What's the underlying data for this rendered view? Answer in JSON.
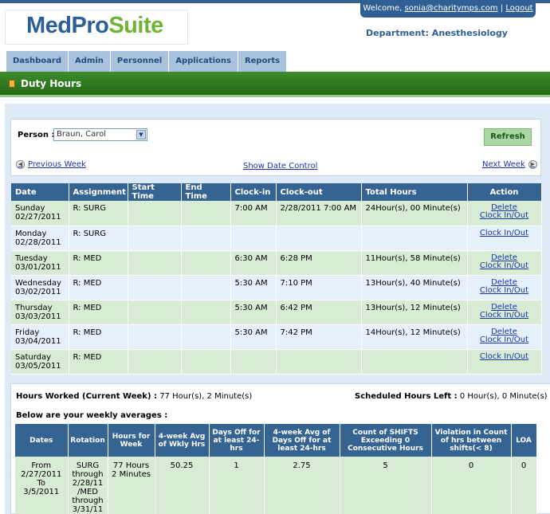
{
  "logo": {
    "part1": "MedPro",
    "part2": "Suite"
  },
  "header": {
    "welcome_prefix": "Welcome,",
    "email": "sonia@charitymps.com",
    "separator": "|",
    "logout": "Logout",
    "department": "Department: Anesthesiology"
  },
  "nav": [
    "Dashboard",
    "Admin",
    "Personnel",
    "Applications",
    "Reports"
  ],
  "page_title": "Duty Hours",
  "filters": {
    "person_label": "Person :",
    "person_value": "Braun, Carol",
    "refresh": "Refresh",
    "previous_week": "Previous Week",
    "show_date_control": "Show Date Control",
    "next_week": "Next Week"
  },
  "duty_table": {
    "headers": [
      "Date",
      "Assignment",
      "Start Time",
      "End Time",
      "Clock-in",
      "Clock-out",
      "Total Hours",
      "Action"
    ],
    "delete_label": "Delete",
    "clock_label": "Clock In/Out",
    "rows": [
      {
        "day": "Sunday",
        "date": "02/27/2011",
        "assignment": "R: SURG",
        "start": "",
        "end": "",
        "clock_in": "7:00 AM",
        "clock_out": "2/28/2011 7:00 AM",
        "total": "24Hour(s), 00 Minute(s)"
      },
      {
        "day": "Monday",
        "date": "02/28/2011",
        "assignment": "R: SURG",
        "start": "",
        "end": "",
        "clock_in": "",
        "clock_out": "",
        "total": ""
      },
      {
        "day": "Tuesday",
        "date": "03/01/2011",
        "assignment": "R: MED",
        "start": "",
        "end": "",
        "clock_in": "6:30 AM",
        "clock_out": "6:28 PM",
        "total": "11Hour(s), 58 Minute(s)"
      },
      {
        "day": "Wednesday",
        "date": "03/02/2011",
        "assignment": "R: MED",
        "start": "",
        "end": "",
        "clock_in": "5:30 AM",
        "clock_out": "7:10 PM",
        "total": "13Hour(s), 40 Minute(s)"
      },
      {
        "day": "Thursday",
        "date": "03/03/2011",
        "assignment": "R: MED",
        "start": "",
        "end": "",
        "clock_in": "5:30 AM",
        "clock_out": "6:42 PM",
        "total": "13Hour(s), 12 Minute(s)"
      },
      {
        "day": "Friday",
        "date": "03/04/2011",
        "assignment": "R: MED",
        "start": "",
        "end": "",
        "clock_in": "5:30 AM",
        "clock_out": "7:42 PM",
        "total": "14Hour(s), 12 Minute(s)"
      },
      {
        "day": "Saturday",
        "date": "03/05/2011",
        "assignment": "R: MED",
        "start": "",
        "end": "",
        "clock_in": "",
        "clock_out": "",
        "total": ""
      }
    ]
  },
  "summary": {
    "hours_worked_label": "Hours Worked (Current Week) :",
    "hours_worked_value": "77 Hour(s), 2 Minute(s)",
    "scheduled_left_label": "Scheduled Hours Left :",
    "scheduled_left_value": "0 Hour(s), 0 Minute(s)",
    "averages_title": "Below are your weekly averages :"
  },
  "avg_table": {
    "headers": [
      "Dates",
      "Rotation",
      "Hours for Week",
      "4-week Avg of Wkly Hrs",
      "Days Off for at least 24-hrs",
      "4-week Avg of Days Off for at least 24-hrs",
      "Count of SHIFTS Exceeding 0 Consecutive Hours",
      "Violation in Count of hrs between shifts(< 8)",
      "LOA"
    ],
    "row": {
      "dates": [
        "From",
        "2/27/2011",
        "To",
        "3/5/2011"
      ],
      "rotation": [
        "SURG",
        "through",
        "2/28/11",
        "/MED",
        "through",
        "3/31/11"
      ],
      "hours": [
        "77 Hours",
        "2 Minutes"
      ],
      "avg_wkly": "50.25",
      "days_off": "1",
      "avg_days_off": "2.75",
      "count_shifts": "5",
      "violation": "0",
      "loa": "0"
    }
  },
  "colors": {
    "brand_blue": "#2f5f93",
    "brand_green": "#72b236",
    "title_green": "#2f7a22",
    "header_blue": "#356392"
  }
}
